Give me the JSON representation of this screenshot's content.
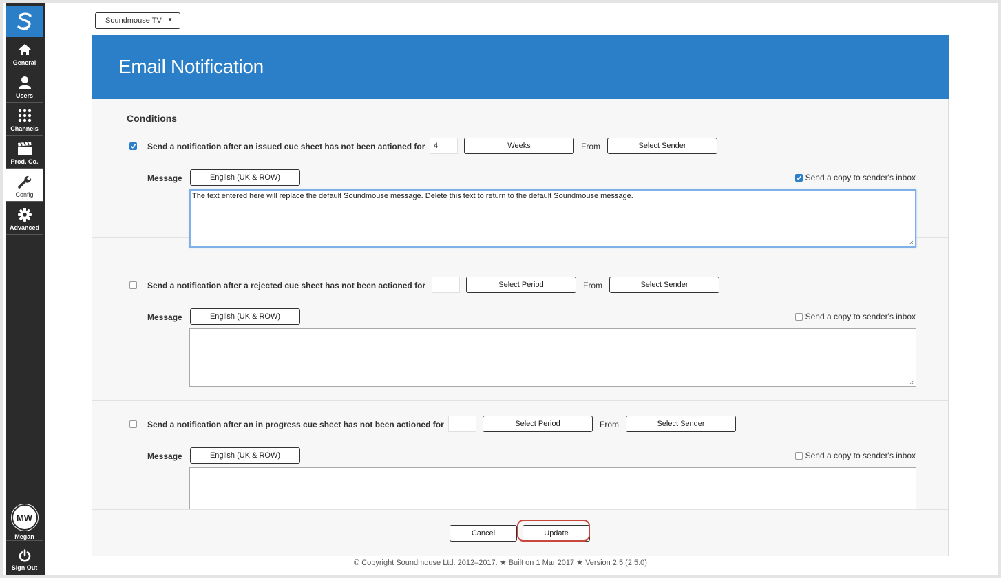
{
  "org_select": {
    "value": "Soundmouse TV"
  },
  "sidebar": {
    "items": [
      {
        "label": "General",
        "icon": "home-icon"
      },
      {
        "label": "Users",
        "icon": "user-icon"
      },
      {
        "label": "Channels",
        "icon": "channels-icon"
      },
      {
        "label": "Prod. Co.",
        "icon": "clapperboard-icon"
      },
      {
        "label": "Config",
        "icon": "wrench-icon",
        "active": true
      },
      {
        "label": "Advanced",
        "icon": "gear-icon"
      }
    ],
    "user": {
      "initials": "MW",
      "name": "Megan"
    },
    "signout_label": "Sign Out"
  },
  "page": {
    "title": "Email Notification",
    "section_title": "Conditions"
  },
  "conditions": [
    {
      "checked": true,
      "text": "Send a notification after an issued cue sheet has not been actioned for",
      "period_value": "4",
      "period_button": "Weeks",
      "from_label": "From",
      "sender_button": "Select Sender",
      "message_label": "Message",
      "language_button": "English (UK & ROW)",
      "copy_checked": true,
      "copy_label": "Send a copy to sender's inbox",
      "message_text": "The text entered here will replace the default Soundmouse message. Delete this text to return to the default Soundmouse message."
    },
    {
      "checked": false,
      "text": "Send a notification after a rejected cue sheet has not been actioned for",
      "period_value": "",
      "period_button": "Select Period",
      "from_label": "From",
      "sender_button": "Select Sender",
      "message_label": "Message",
      "language_button": "English (UK & ROW)",
      "copy_checked": false,
      "copy_label": "Send a copy to sender's inbox",
      "message_text": ""
    },
    {
      "checked": false,
      "text": "Send a notification after an in progress cue sheet has not been actioned for",
      "period_value": "",
      "period_button": "Select Period",
      "from_label": "From",
      "sender_button": "Select Sender",
      "message_label": "Message",
      "language_button": "English (UK & ROW)",
      "copy_checked": false,
      "copy_label": "Send a copy to sender's inbox",
      "message_text": ""
    }
  ],
  "footer": {
    "cancel_label": "Cancel",
    "update_label": "Update"
  },
  "copyright": "© Copyright Soundmouse Ltd. 2012–2017. ★ Built on 1 Mar 2017 ★ Version 2.5 (2.5.0)",
  "colors": {
    "brand_blue": "#2b7fc9",
    "sidebar_bg": "#2b2b2b",
    "highlight_red": "#c9473d"
  }
}
